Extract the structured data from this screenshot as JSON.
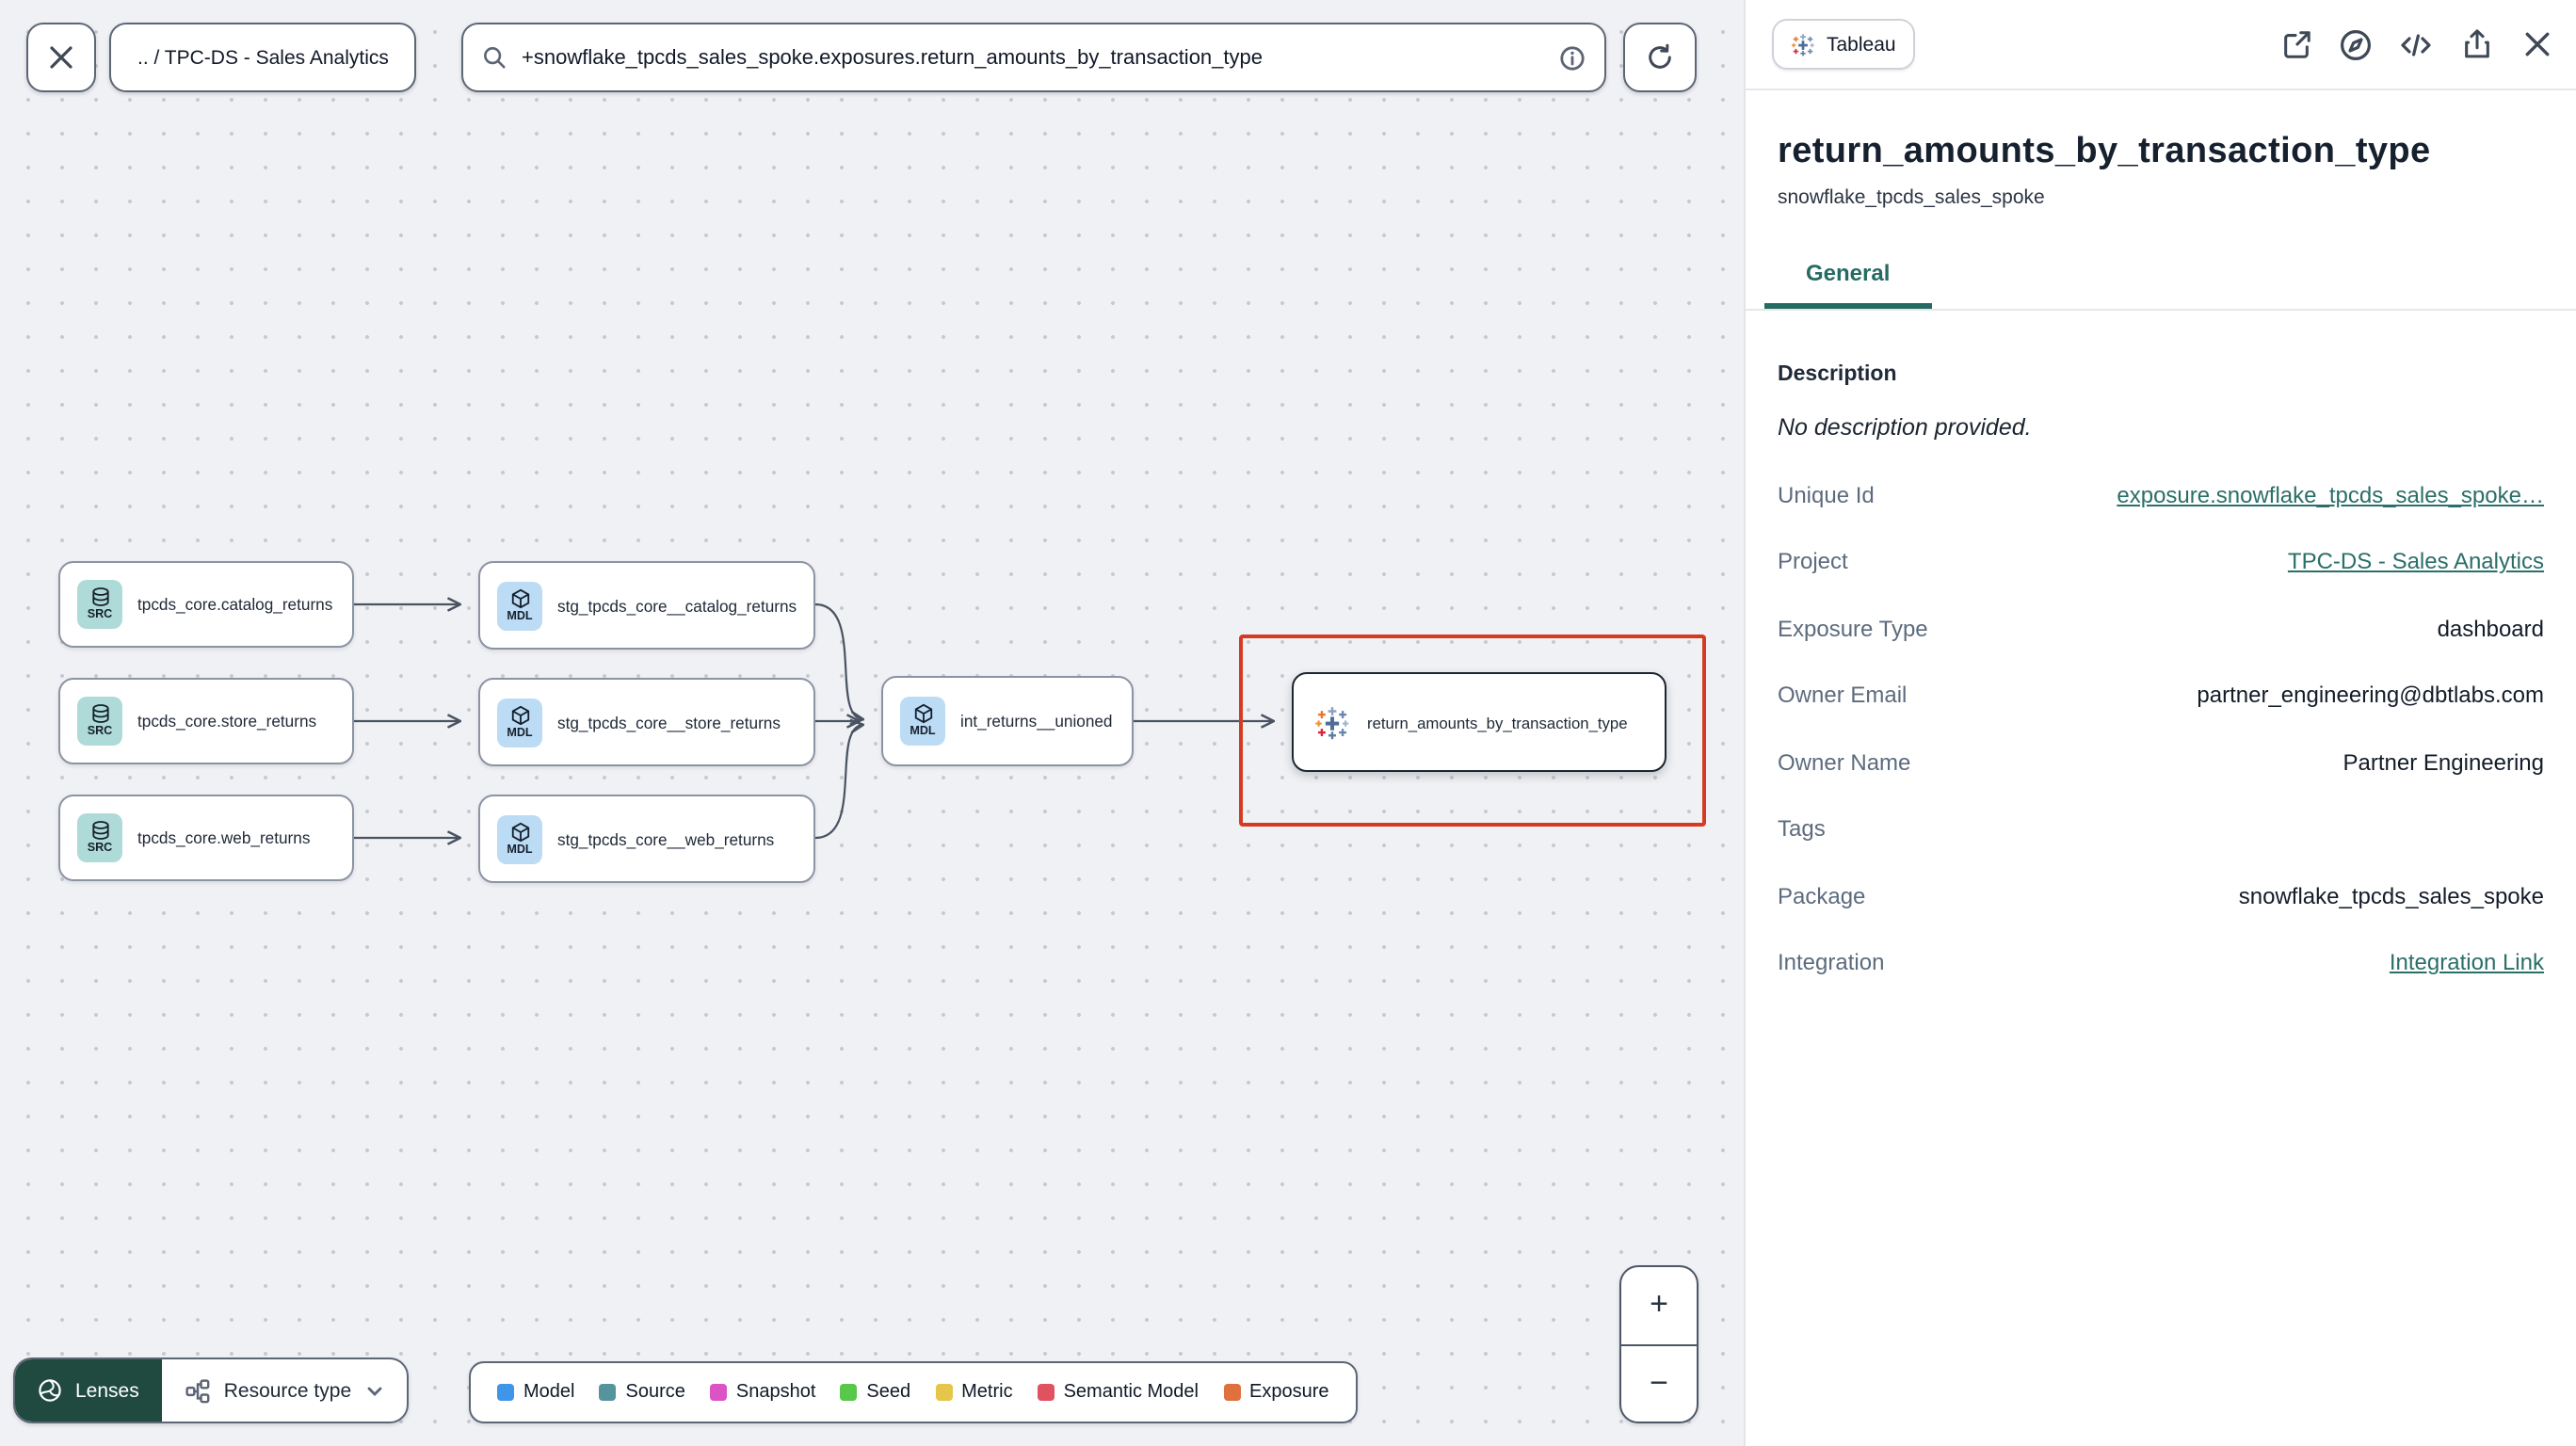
{
  "topbar": {
    "breadcrumb": ".. / TPC-DS - Sales Analytics",
    "search_query": "+snowflake_tpcds_sales_spoke.exposures.return_amounts_by_transaction_type"
  },
  "canvas": {
    "nodes": [
      {
        "badge": "SRC",
        "label": "tpcds_core.catalog_returns"
      },
      {
        "badge": "SRC",
        "label": "tpcds_core.store_returns"
      },
      {
        "badge": "SRC",
        "label": "tpcds_core.web_returns"
      },
      {
        "badge": "MDL",
        "label": "stg_tpcds_core__catalog_returns"
      },
      {
        "badge": "MDL",
        "label": "stg_tpcds_core__store_returns"
      },
      {
        "badge": "MDL",
        "label": "stg_tpcds_core__web_returns"
      },
      {
        "badge": "MDL",
        "label": "int_returns__unioned"
      },
      {
        "badge": "tableau-icon",
        "label": "return_amounts_by_transaction_type"
      }
    ],
    "zoom_in": "+",
    "zoom_out": "−"
  },
  "toolbar": {
    "lenses_label": "Lenses",
    "resource_type_label": "Resource type"
  },
  "legend": {
    "items": [
      {
        "label": "Model",
        "color": "#3f96e8"
      },
      {
        "label": "Source",
        "color": "#55949c"
      },
      {
        "label": "Snapshot",
        "color": "#dc53c5"
      },
      {
        "label": "Seed",
        "color": "#57c84a"
      },
      {
        "label": "Metric",
        "color": "#e5c54a"
      },
      {
        "label": "Semantic Model",
        "color": "#e05260"
      },
      {
        "label": "Exposure",
        "color": "#e0703d"
      }
    ]
  },
  "panel": {
    "tool_badge": "Tableau",
    "title": "return_amounts_by_transaction_type",
    "subtitle": "snowflake_tpcds_sales_spoke",
    "tab_general": "General",
    "description_label": "Description",
    "description_value": "No description provided.",
    "accent_color": "#266b63",
    "fields": [
      {
        "label": "Unique Id",
        "value": "exposure.snowflake_tpcds_sales_spoke…"
      },
      {
        "label": "Project",
        "value": "TPC-DS - Sales Analytics"
      },
      {
        "label": "Exposure Type",
        "value": "dashboard"
      },
      {
        "label": "Owner Email",
        "value": "partner_engineering@dbtlabs.com"
      },
      {
        "label": "Owner Name",
        "value": "Partner Engineering"
      },
      {
        "label": "Tags",
        "value": ""
      },
      {
        "label": "Package",
        "value": "snowflake_tpcds_sales_spoke"
      },
      {
        "label": "Integration",
        "value": "Integration Link"
      }
    ]
  }
}
